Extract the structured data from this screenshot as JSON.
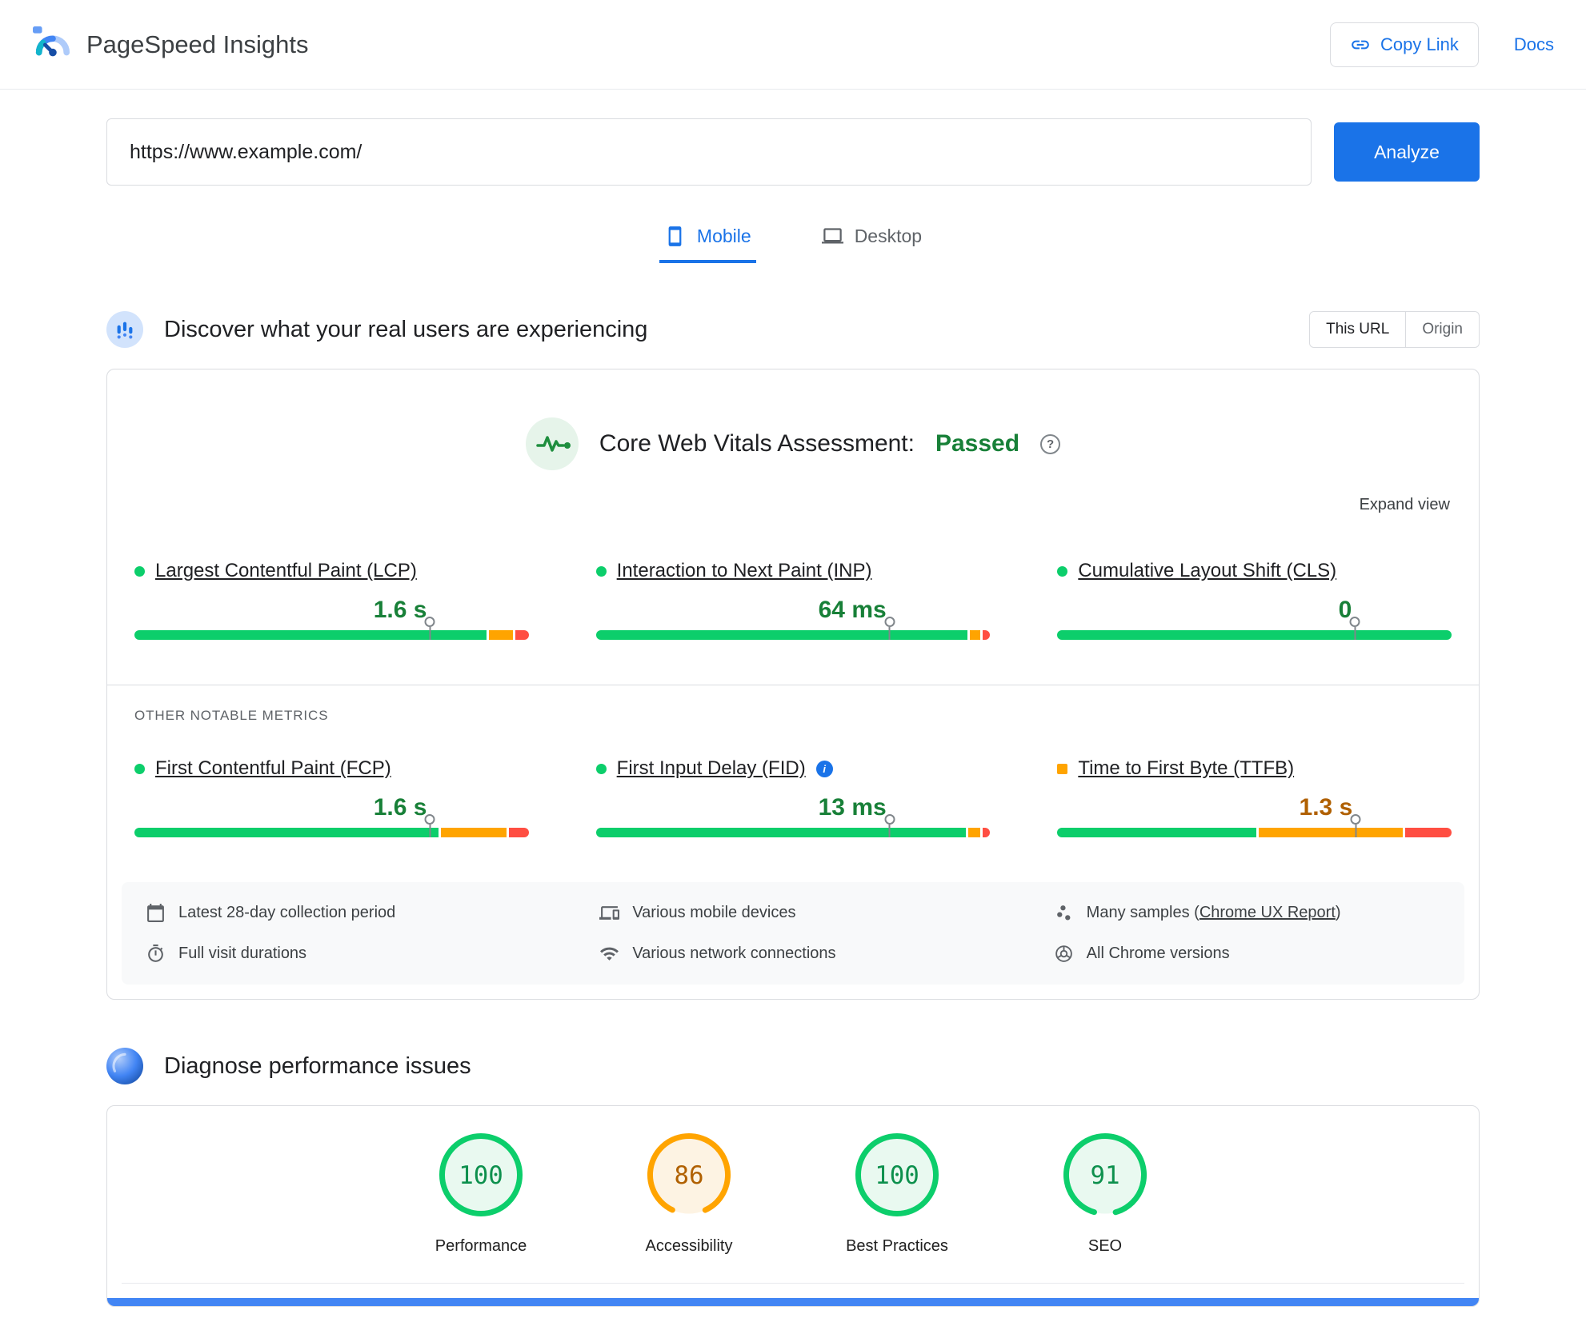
{
  "colors": {
    "accent": "#1a73e8",
    "good": "#0cce6b",
    "good_text": "#188038",
    "average": "#ffa400",
    "average_text": "#b06000",
    "poor": "#ff4e42"
  },
  "header": {
    "title": "PageSpeed Insights",
    "copy_link": "Copy Link",
    "docs": "Docs"
  },
  "url_bar": {
    "value": "https://www.example.com/",
    "analyze": "Analyze"
  },
  "tabs": {
    "mobile": "Mobile",
    "desktop": "Desktop"
  },
  "field": {
    "title": "Discover what your real users are experiencing",
    "toggle": {
      "this_url": "This URL",
      "origin": "Origin"
    },
    "assessment_label": "Core Web Vitals Assessment:",
    "assessment_result": "Passed",
    "expand_view": "Expand view",
    "other_metrics_label": "OTHER NOTABLE METRICS",
    "core_metrics": [
      {
        "name": "Largest Contentful Paint (LCP)",
        "value": "1.6 s",
        "status": "good",
        "segments": [
          0.905,
          0.06,
          0.035
        ],
        "marker": 0.75
      },
      {
        "name": "Interaction to Next Paint (INP)",
        "value": "64 ms",
        "status": "good",
        "segments": [
          0.955,
          0.025,
          0.02
        ],
        "marker": 0.745
      },
      {
        "name": "Cumulative Layout Shift (CLS)",
        "value": "0",
        "status": "good",
        "segments": [
          1,
          0,
          0
        ],
        "marker": 0.755
      }
    ],
    "other_metrics": [
      {
        "name": "First Contentful Paint (FCP)",
        "value": "1.6 s",
        "status": "good",
        "segments": [
          0.78,
          0.17,
          0.05
        ],
        "marker": 0.75
      },
      {
        "name": "First Input Delay (FID)",
        "value": "13 ms",
        "status": "good",
        "segments": [
          0.95,
          0.03,
          0.02
        ],
        "marker": 0.745,
        "info": true
      },
      {
        "name": "Time to First Byte (TTFB)",
        "value": "1.3 s",
        "status": "average",
        "segments": [
          0.51,
          0.37,
          0.12
        ],
        "marker": 0.757,
        "flask": true
      }
    ],
    "collection_details": [
      {
        "icon": "calendar-icon",
        "text": "Latest 28-day collection period"
      },
      {
        "icon": "devices-icon",
        "text": "Various mobile devices"
      },
      {
        "icon": "samples-icon",
        "prefix": "Many samples (",
        "link": "Chrome UX Report",
        "suffix": ")"
      },
      {
        "icon": "stopwatch-icon",
        "text": "Full visit durations"
      },
      {
        "icon": "network-icon",
        "text": "Various network connections"
      },
      {
        "icon": "chrome-icon",
        "text": "All Chrome versions"
      }
    ]
  },
  "diagnose": {
    "title": "Diagnose performance issues"
  },
  "scores": [
    {
      "value": 100,
      "label": "Performance"
    },
    {
      "value": 86,
      "label": "Accessibility"
    },
    {
      "value": 100,
      "label": "Best Practices"
    },
    {
      "value": 91,
      "label": "SEO"
    }
  ]
}
